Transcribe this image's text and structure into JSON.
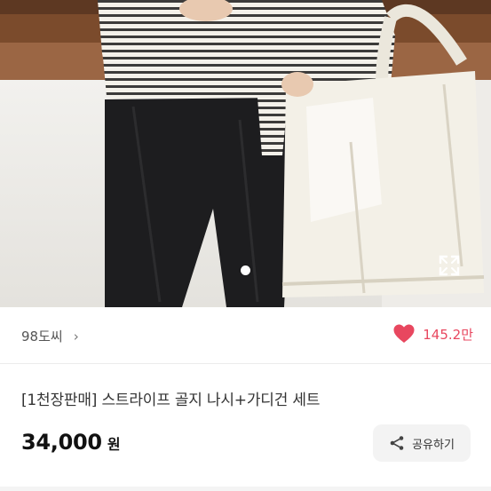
{
  "seller": {
    "name": "98도씨",
    "chevron": "›"
  },
  "like": {
    "count": "145.2만",
    "icon": "heart-icon",
    "color": "#e8475f"
  },
  "product": {
    "title": "[1천장판매] 스트라이프 골지 나시+가디건 세트",
    "price": "34,000",
    "currency": "원"
  },
  "share": {
    "label": "공유하기",
    "icon": "share-icon"
  },
  "gallery": {
    "expand_icon": "expand-icon",
    "pager_current": 1
  }
}
